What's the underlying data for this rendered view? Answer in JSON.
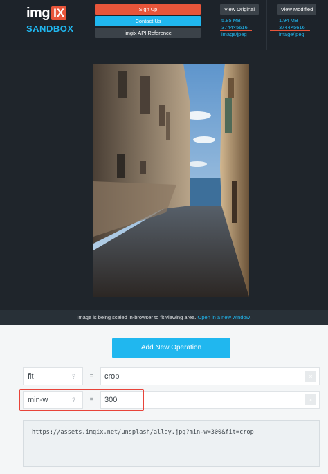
{
  "logo": {
    "img_text": "img",
    "ix_text": "IX",
    "sandbox_text": "SANDBOX"
  },
  "header": {
    "signup_label": "Sign Up",
    "contact_label": "Contact Us",
    "api_label": "imgix API Reference",
    "original": {
      "button_label": "View Original",
      "size": "5.85 MB",
      "dimensions": "3744×5616",
      "format": "image/jpeg"
    },
    "modified": {
      "button_label": "View Modified",
      "size": "1.94 MB",
      "dimensions": "3744×5616",
      "format": "image/jpeg"
    }
  },
  "viewer": {
    "scale_message": "Image is being scaled in-browser to fit viewing area.",
    "open_link": "Open in a new window"
  },
  "operations": {
    "add_button_label": "Add New Operation",
    "params": [
      {
        "key": "fit",
        "help": "?",
        "equals": "=",
        "value": "crop",
        "remove": "×"
      },
      {
        "key": "min-w",
        "help": "?",
        "equals": "=",
        "value": "300",
        "remove": "×"
      }
    ],
    "url": "https://assets.imgix.net/unsplash/alley.jpg?min-w=300&fit=crop"
  },
  "colors": {
    "brand_orange": "#e8553a",
    "brand_blue": "#20b7ef",
    "header_bg": "#1d232a",
    "highlight_red": "#e8443a"
  }
}
